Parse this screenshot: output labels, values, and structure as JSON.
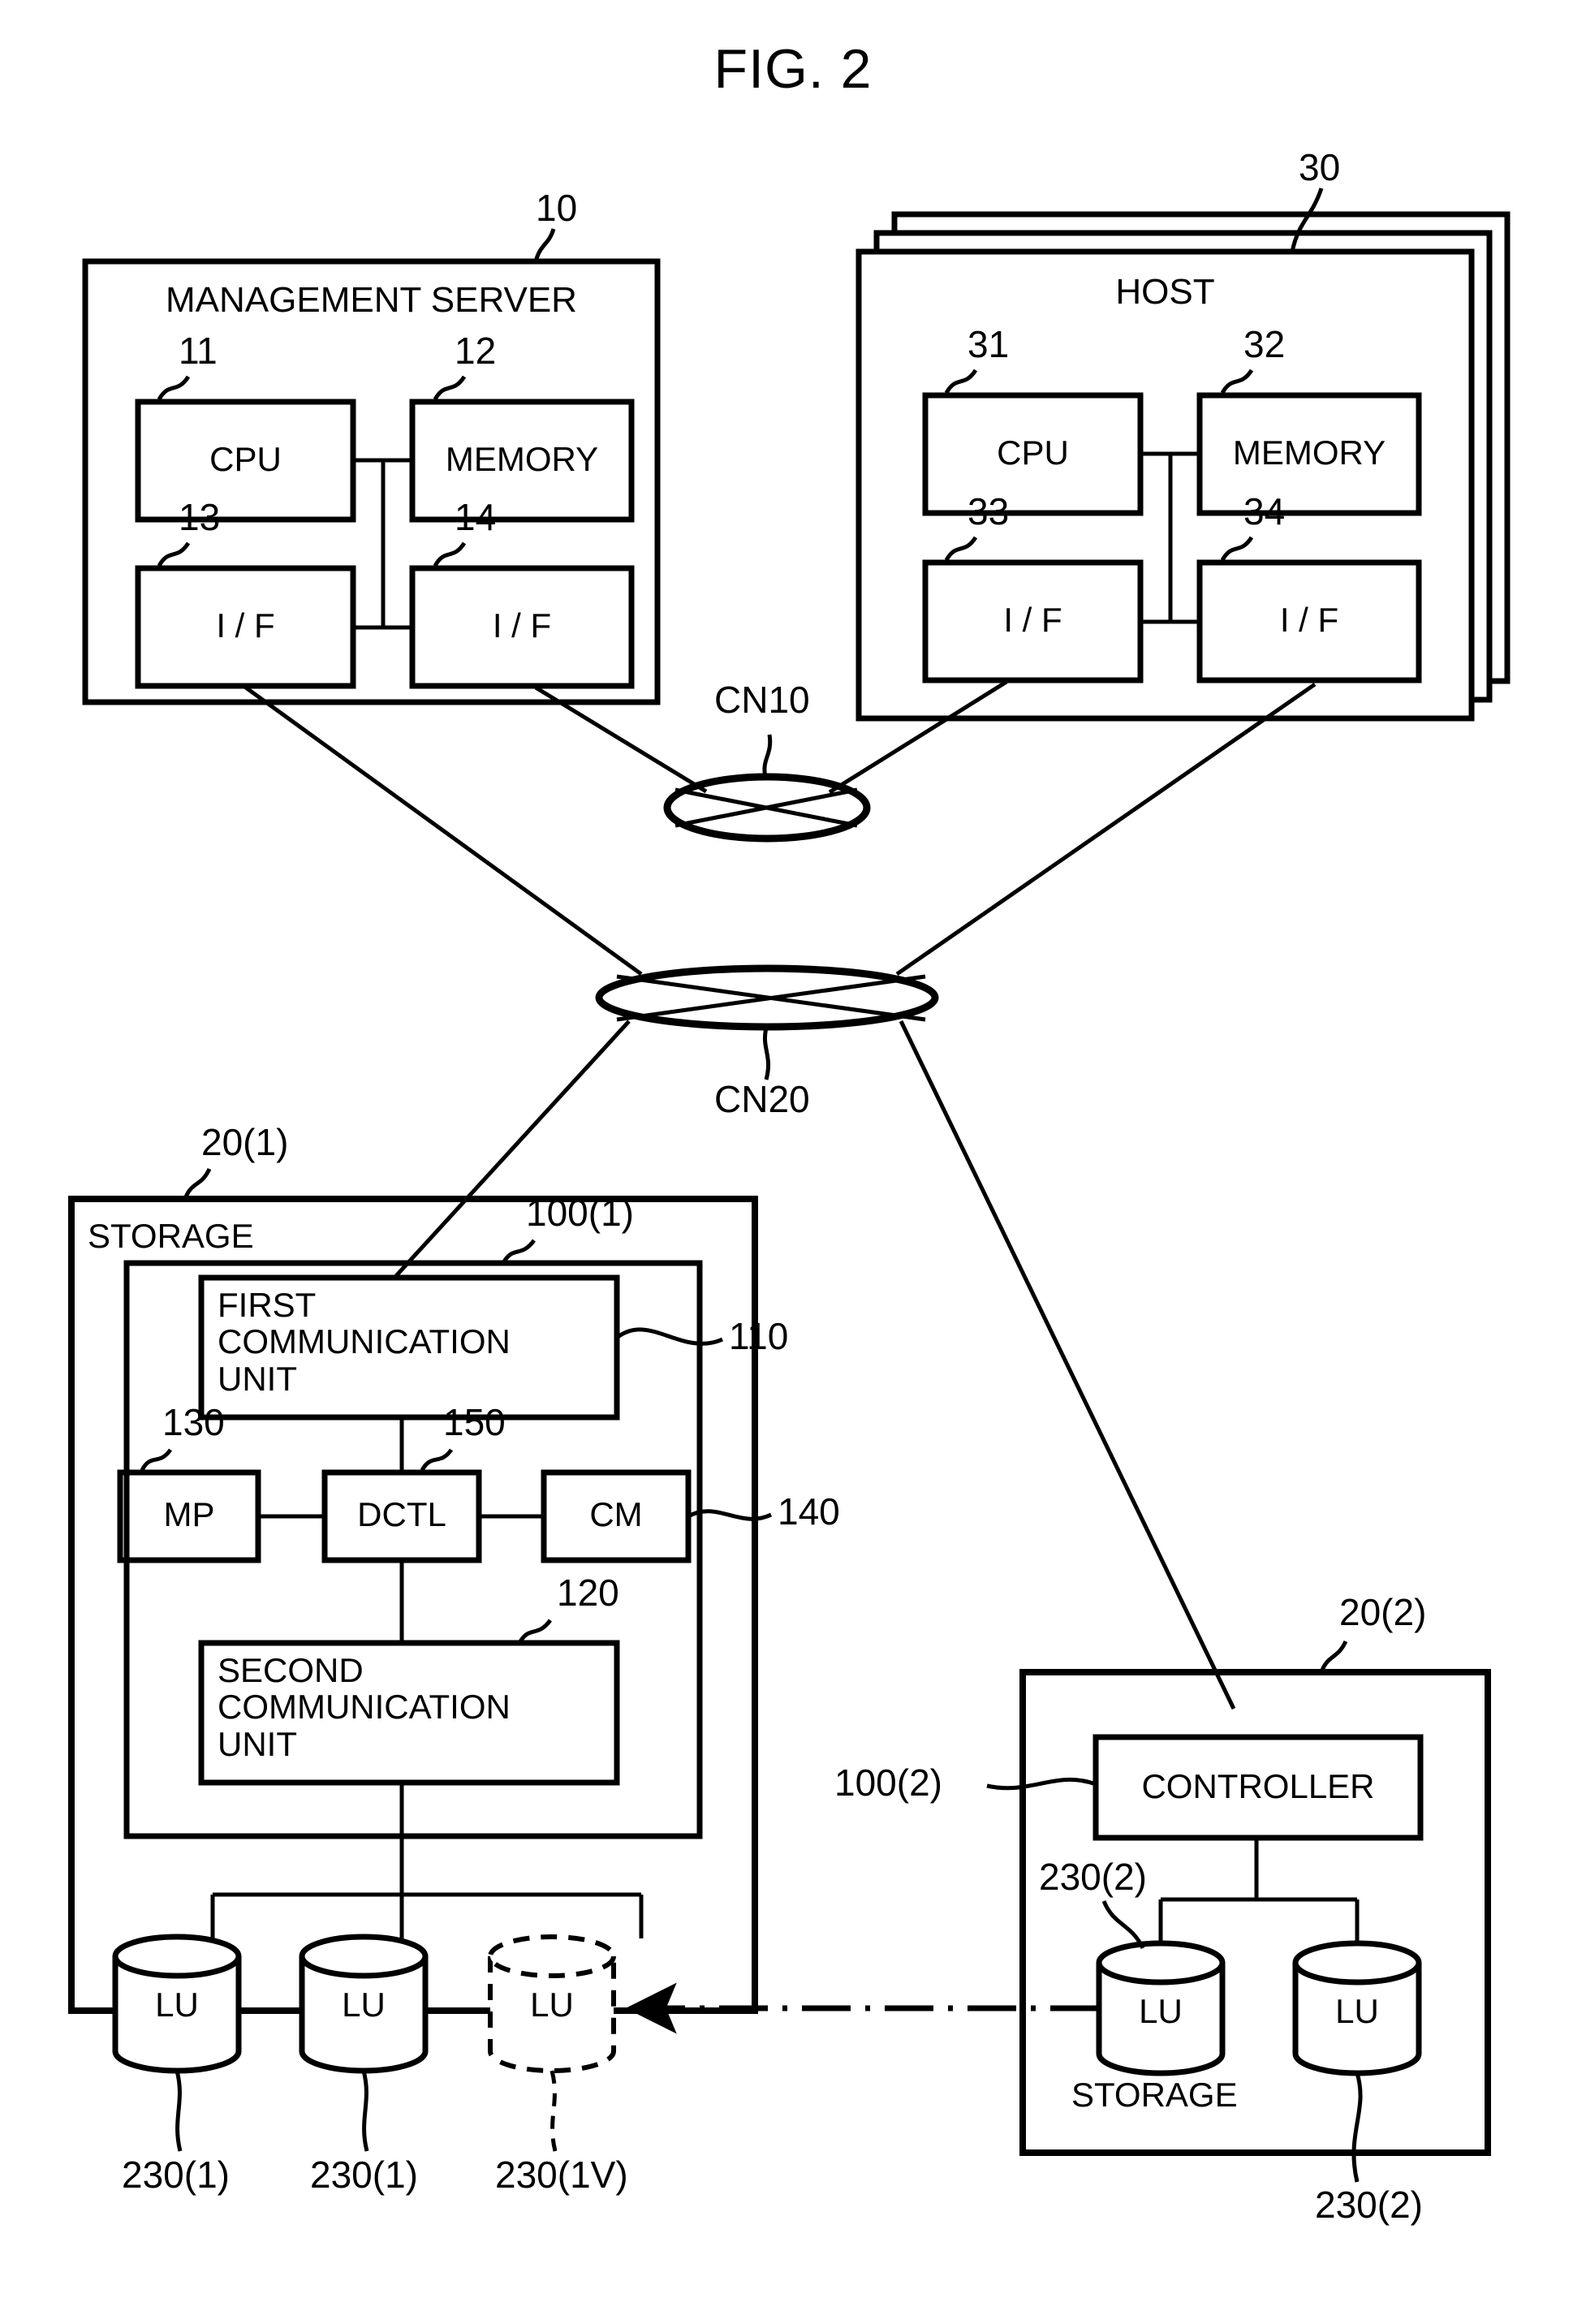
{
  "figure": {
    "title": "FIG. 2"
  },
  "management_server": {
    "title": "MANAGEMENT SERVER",
    "ref": "10",
    "components": [
      {
        "label": "CPU",
        "ref": "11"
      },
      {
        "label": "MEMORY",
        "ref": "12"
      },
      {
        "label": "I / F",
        "ref": "13"
      },
      {
        "label": "I / F",
        "ref": "14"
      }
    ]
  },
  "host": {
    "title": "HOST",
    "ref": "30",
    "components": [
      {
        "label": "CPU",
        "ref": "31"
      },
      {
        "label": "MEMORY",
        "ref": "32"
      },
      {
        "label": "I / F",
        "ref": "33"
      },
      {
        "label": "I / F",
        "ref": "34"
      }
    ]
  },
  "networks": [
    {
      "label": "CN10"
    },
    {
      "label": "CN20"
    }
  ],
  "storage1": {
    "title": "STORAGE",
    "ref": "20(1)",
    "controller_ref": "100(1)",
    "first_comm_unit": {
      "label": "FIRST\nCOMMUNICATION\nUNIT",
      "ref": "110"
    },
    "second_comm_unit": {
      "label": "SECOND\nCOMMUNICATION\nUNIT",
      "ref": "120"
    },
    "mp": {
      "label": "MP",
      "ref": "130"
    },
    "dctl": {
      "label": "DCTL",
      "ref": "150"
    },
    "cm": {
      "label": "CM",
      "ref": "140"
    },
    "volumes": [
      {
        "label": "LU",
        "ref": "230(1)",
        "virtual": false
      },
      {
        "label": "LU",
        "ref": "230(1)",
        "virtual": false
      },
      {
        "label": "LU",
        "ref": "230(1V)",
        "virtual": true
      }
    ]
  },
  "storage2": {
    "title": "STORAGE",
    "ref": "20(2)",
    "controller": {
      "label": "CONTROLLER",
      "ref": "100(2)"
    },
    "volume_ref_top": "230(2)",
    "volume_ref_bottom": "230(2)",
    "volumes": [
      {
        "label": "LU"
      },
      {
        "label": "LU"
      }
    ]
  },
  "colors": {
    "line": "#000000",
    "background": "#ffffff"
  }
}
